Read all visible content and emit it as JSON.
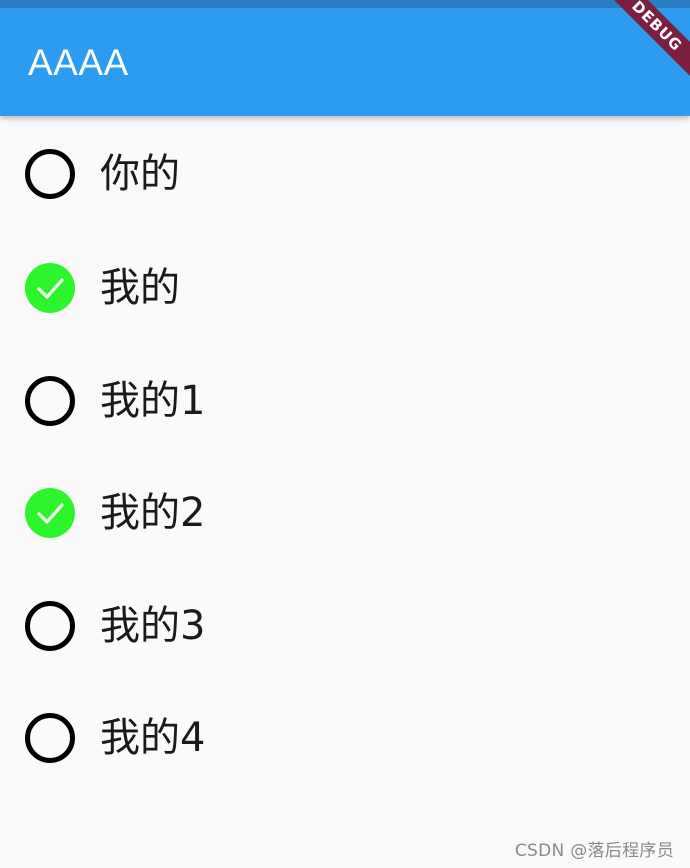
{
  "app_bar": {
    "title": "AAAA",
    "color": "#2d9bef"
  },
  "debug_banner": {
    "label": "DEBUG",
    "color": "#7b1f3c"
  },
  "options": [
    {
      "label": "你的",
      "checked": false
    },
    {
      "label": "我的",
      "checked": true
    },
    {
      "label": "我的1",
      "checked": false
    },
    {
      "label": "我的2",
      "checked": true
    },
    {
      "label": "我的3",
      "checked": false
    },
    {
      "label": "我的4",
      "checked": false
    }
  ],
  "checked_color": "#2cf52c",
  "watermark": "CSDN @落后程序员"
}
